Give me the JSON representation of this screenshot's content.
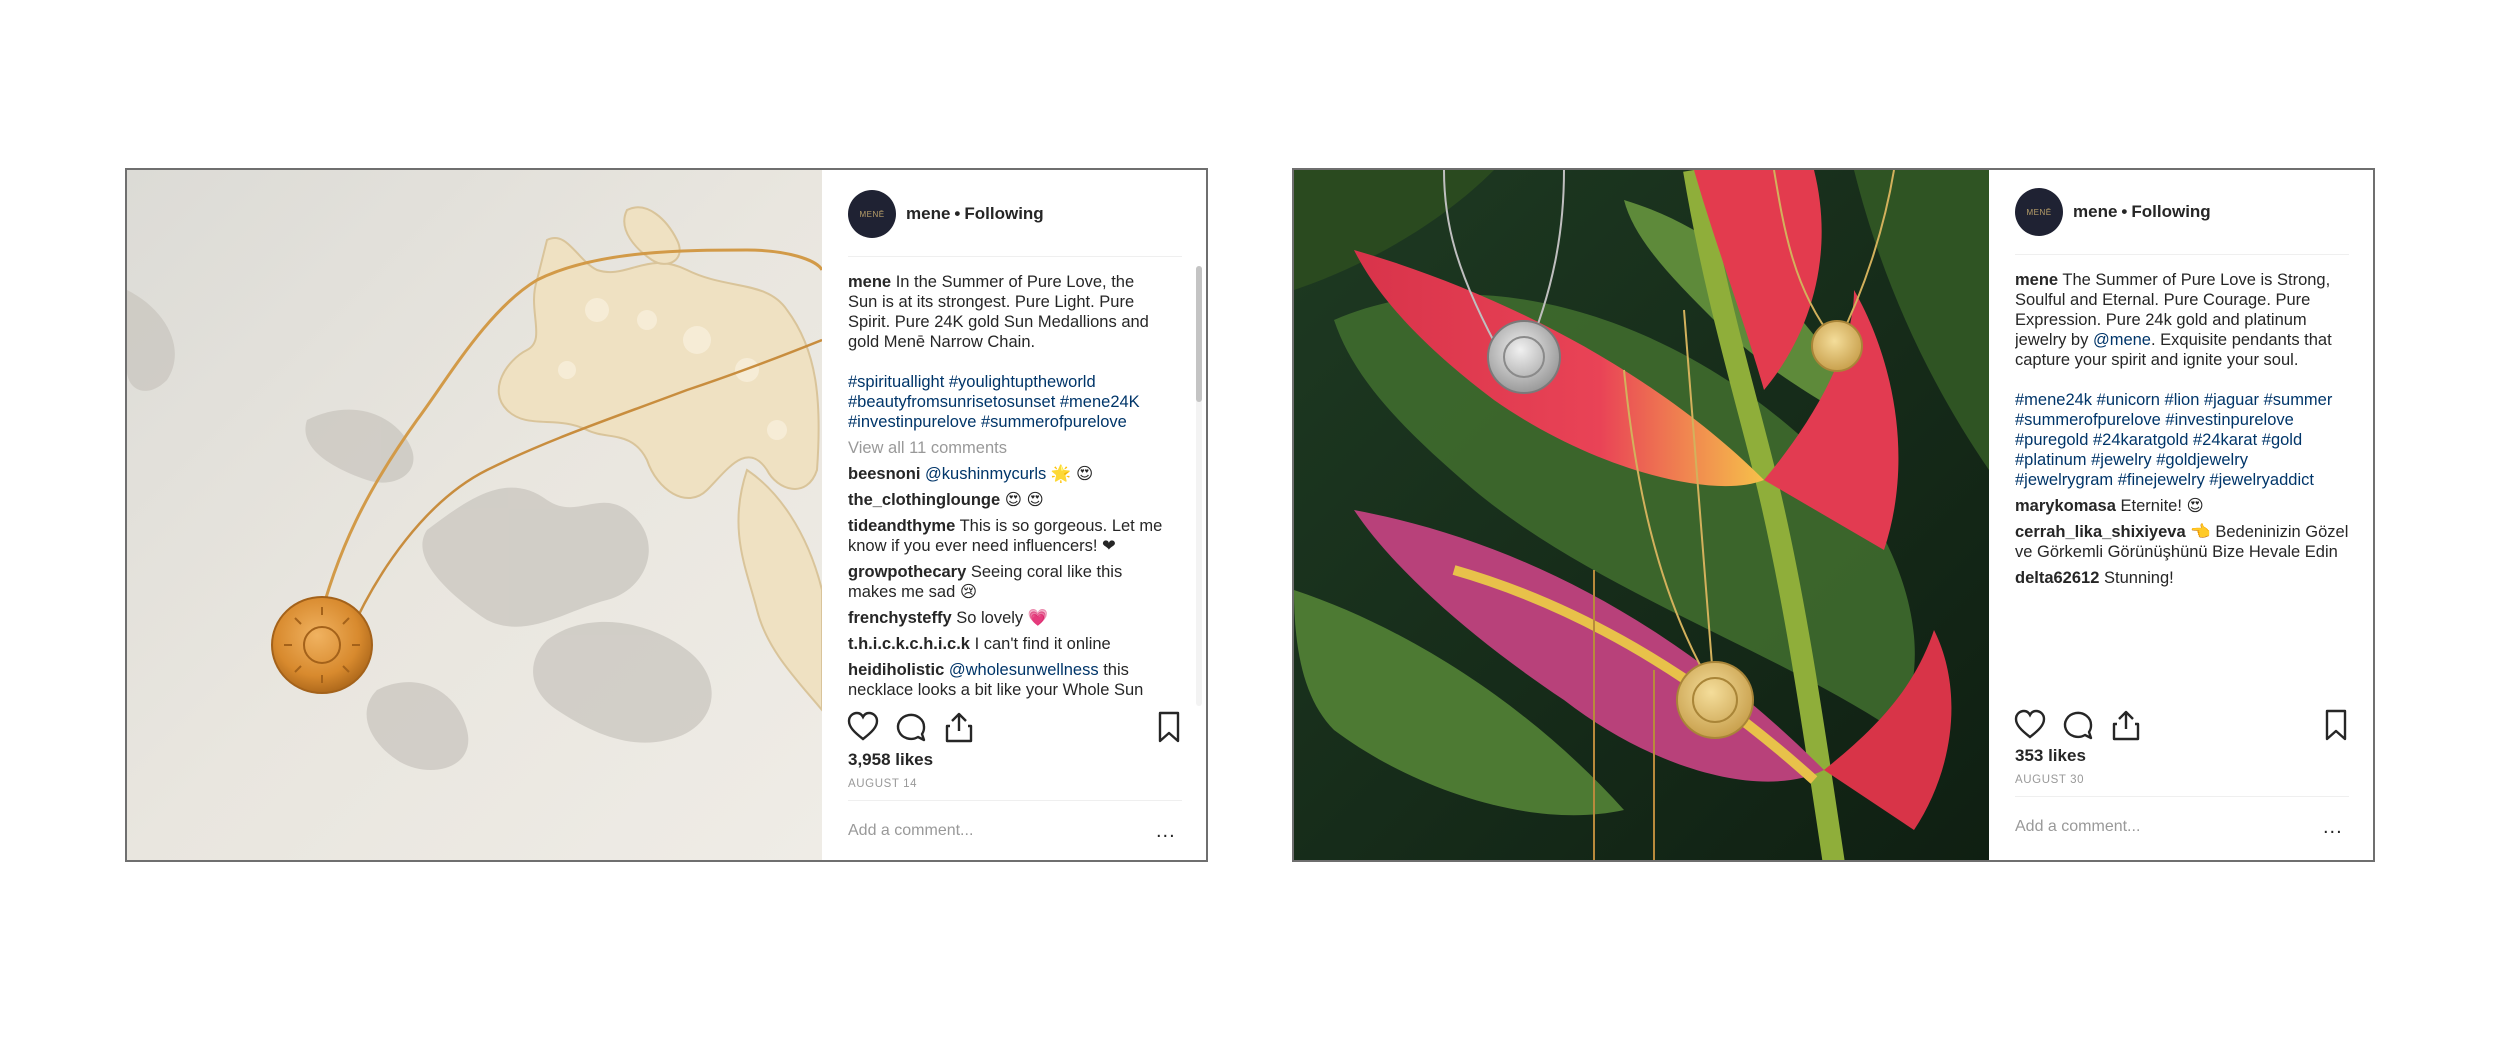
{
  "posts": [
    {
      "account": "mene",
      "separator": "•",
      "follow_status": "Following",
      "avatar_text": "MENĒ",
      "caption_user": "mene",
      "caption_text": "In the Summer of Pure Love, the Sun is at its strongest. Pure Light. Pure Spirit. Pure 24K gold Sun Medallions and gold Menē Narrow Chain.",
      "hashtags": "#spirituallight #youlightuptheworld #beautyfromsunrisetosunset #mene24K #investinpurelove #summerofpurelove",
      "view_all": "View all 11 comments",
      "comments": [
        {
          "user": "beesnoni",
          "mention": "@kushinmycurls",
          "text": " 🌟 😍"
        },
        {
          "user": "the_clothinglounge",
          "mention": "",
          "text": "😍 😍"
        },
        {
          "user": "tideandthyme",
          "mention": "",
          "text": "This is so gorgeous. Let me know if you ever need influencers! ❤"
        },
        {
          "user": "growpothecary",
          "mention": "",
          "text": "Seeing coral like this makes me sad 😢"
        },
        {
          "user": "frenchysteffy",
          "mention": "",
          "text": "So lovely 💗"
        },
        {
          "user": "t.h.i.c.k.c.h.i.c.k",
          "mention": "",
          "text": "I can't find it online"
        },
        {
          "user": "heidiholistic",
          "mention": "@wholesunwellness",
          "text": " this necklace looks a bit like your Whole Sun"
        }
      ],
      "likes": "3,958 likes",
      "date": "AUGUST 14",
      "add_comment_placeholder": "Add a comment...",
      "more": "..."
    },
    {
      "account": "mene",
      "separator": "•",
      "follow_status": "Following",
      "avatar_text": "MENĒ",
      "caption_user": "mene",
      "caption_text": "The Summer of Pure Love is Strong, Soulful and Eternal. Pure Courage. Pure Expression. Pure 24k gold and platinum jewelry by",
      "caption_mention": "@mene",
      "caption_text_after": ". Exquisite pendants that capture your spirit and ignite your soul.",
      "hashtags": "#mene24k #unicorn #lion #jaguar #summer #summerofpurelove #investinpurelove #puregold #24karatgold #24karat #gold #platinum #jewelry #goldjewelry #jewelrygram #finejewelry #jewelryaddict",
      "comments": [
        {
          "user": "marykomasa",
          "mention": "",
          "text": "Eternite! 😍"
        },
        {
          "user": "cerrah_lika_shixiyeva",
          "mention": "",
          "text": "👈 Bedeninizin Gözel ve Görkemli Görünüşhünü Bize Hevale Edin"
        },
        {
          "user": "delta62612",
          "mention": "",
          "text": "Stunning!"
        }
      ],
      "likes": "353 likes",
      "date": "AUGUST 30",
      "add_comment_placeholder": "Add a comment...",
      "more": "..."
    }
  ],
  "icons": [
    "heart-icon",
    "comment-icon",
    "share-icon",
    "bookmark-icon"
  ],
  "colors": {
    "link": "#003569",
    "muted": "#999999",
    "avatar_bg": "#1f2233"
  }
}
